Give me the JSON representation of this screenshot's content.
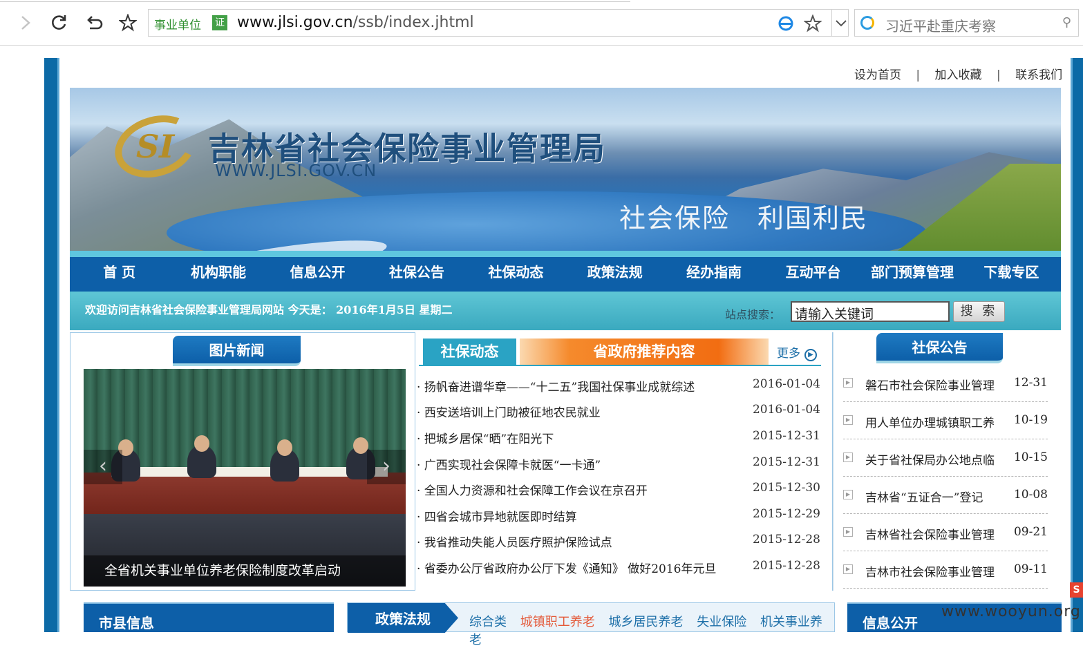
{
  "browser": {
    "cert_label": "事业单位",
    "cert_badge": "证",
    "url_host": "www.jlsi.gov.cn",
    "url_path": "/ssb/index.jhtml",
    "search_text": "习近平赴重庆考察"
  },
  "toplinks": {
    "homepage": "设为首页",
    "sep": "|",
    "favorite": "加入收藏",
    "contact": "联系我们"
  },
  "banner": {
    "title": "吉林省社会保险事业管理局",
    "site": "WWW.JLSI.GOV.CN",
    "slogan": "社会保险　利国利民",
    "logo_text": "SI"
  },
  "nav": [
    "首 页",
    "机构职能",
    "信息公开",
    "社保公告",
    "社保动态",
    "政策法规",
    "经办指南",
    "互动平台",
    "部门预算管理",
    "下载专区"
  ],
  "welcome": {
    "message": "欢迎访问吉林省社会保险事业管理局网站 今天是： 2016年1月5日 星期二",
    "search_label": "站点搜索：",
    "search_value": "请输入关键词",
    "search_button": "搜 索"
  },
  "photo_news": {
    "title": "图片新闻",
    "caption": "全省机关事业单位养老保险制度改革启动",
    "prev": "‹",
    "next": "›"
  },
  "news_tabs": {
    "active": "社保动态",
    "other": "省政府推荐内容",
    "more": "更多"
  },
  "news": [
    {
      "title": "扬帆奋进谱华章——“十二五”我国社保事业成就综述",
      "date": "2016-01-04"
    },
    {
      "title": "西安送培训上门助被征地农民就业",
      "date": "2016-01-04"
    },
    {
      "title": "把城乡居保“晒”在阳光下",
      "date": "2015-12-31"
    },
    {
      "title": "广西实现社会保障卡就医“一卡通”",
      "date": "2015-12-31"
    },
    {
      "title": "全国人力资源和社会保障工作会议在京召开",
      "date": "2015-12-30"
    },
    {
      "title": "四省会城市异地就医即时结算",
      "date": "2015-12-29"
    },
    {
      "title": "我省推动失能人员医疗照护保险试点",
      "date": "2015-12-28"
    },
    {
      "title": "省委办公厅省政府办公厅下发《通知》 做好2016年元旦",
      "date": "2015-12-28"
    }
  ],
  "announcements": {
    "title": "社保公告",
    "items": [
      {
        "title": "磐石市社会保险事业管理",
        "date": "12-31"
      },
      {
        "title": "用人单位办理城镇职工养",
        "date": "10-19"
      },
      {
        "title": "关于省社保局办公地点临",
        "date": "10-15"
      },
      {
        "title": "吉林省“五证合一”登记",
        "date": "10-08"
      },
      {
        "title": "吉林省社会保险事业管理",
        "date": "09-21"
      },
      {
        "title": "吉林市社会保险事业管理",
        "date": "09-11"
      }
    ]
  },
  "bottom": {
    "county": "市县信息",
    "policy": "政策法规",
    "policy_links": [
      "综合类",
      "城镇职工养老",
      "城乡居民养老",
      "失业保险",
      "机关事业养老"
    ],
    "info": "信息公开"
  },
  "watermark": "www.wooyun.org",
  "side_badge": "S",
  "colors": {
    "nav_blue": "#0d5fa8",
    "teal": "#2aa3c4",
    "orange": "#f26d12",
    "hot_link": "#e45a3a"
  }
}
